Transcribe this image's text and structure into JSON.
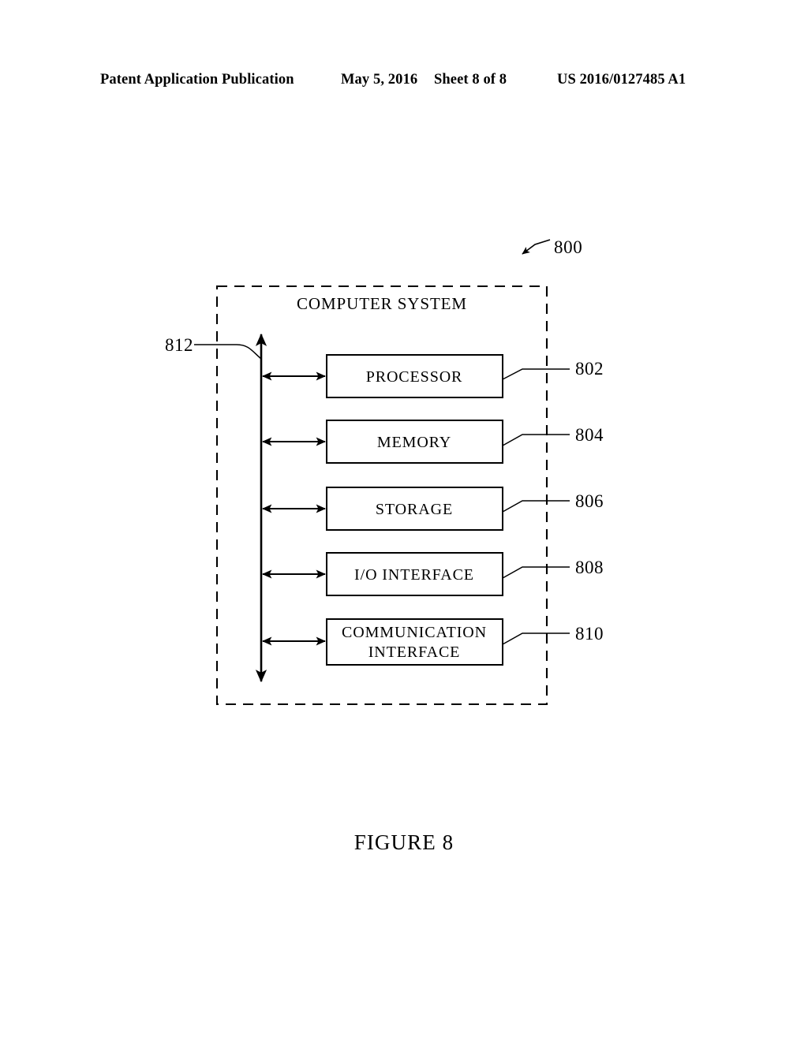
{
  "header": {
    "publication": "Patent Application Publication",
    "date": "May 5, 2016",
    "sheet": "Sheet 8 of 8",
    "patent_number": "US 2016/0127485 A1"
  },
  "figure": {
    "caption": "FIGURE 8",
    "system_callout": "800",
    "system_title": "COMPUTER SYSTEM",
    "bus_label": "812",
    "blocks": [
      {
        "label": "PROCESSOR",
        "ref": "802"
      },
      {
        "label": "MEMORY",
        "ref": "804"
      },
      {
        "label": "STORAGE",
        "ref": "806"
      },
      {
        "label": "I/O INTERFACE",
        "ref": "808"
      },
      {
        "label": "COMMUNICATION\nINTERFACE",
        "ref": "810"
      }
    ],
    "block_line1": [
      "PROCESSOR",
      "MEMORY",
      "STORAGE",
      "I/O INTERFACE",
      "COMMUNICATION"
    ],
    "block_line2": [
      "",
      "",
      "",
      "",
      "INTERFACE"
    ],
    "colors": {
      "ink": "#000000",
      "paper": "#ffffff"
    }
  }
}
